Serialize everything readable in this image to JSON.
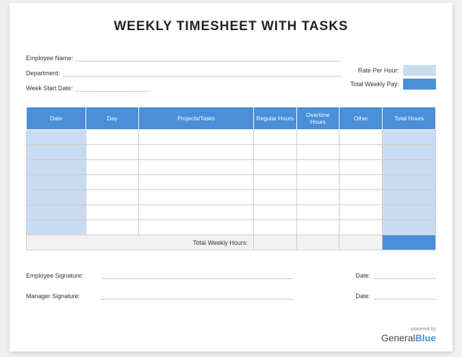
{
  "title": "WEEKLY TIMESHEET WITH TASKS",
  "fields": {
    "employee_name_label": "Employee Name:",
    "department_label": "Department:",
    "week_start_label": "Week Start Date:",
    "rate_label": "Rate Per Hour:",
    "total_pay_label": "Total Weekly Pay:"
  },
  "table": {
    "headers": {
      "date": "Date",
      "day": "Day",
      "projects": "Projects/Tasks",
      "regular": "Regular Hours",
      "overtime": "Overtime Hours",
      "other": "Other",
      "total": "Total Hours"
    },
    "rows": [
      {
        "date": "",
        "day": "",
        "proj": "",
        "reg": "",
        "ot": "",
        "other": "",
        "total": ""
      },
      {
        "date": "",
        "day": "",
        "proj": "",
        "reg": "",
        "ot": "",
        "other": "",
        "total": ""
      },
      {
        "date": "",
        "day": "",
        "proj": "",
        "reg": "",
        "ot": "",
        "other": "",
        "total": ""
      },
      {
        "date": "",
        "day": "",
        "proj": "",
        "reg": "",
        "ot": "",
        "other": "",
        "total": ""
      },
      {
        "date": "",
        "day": "",
        "proj": "",
        "reg": "",
        "ot": "",
        "other": "",
        "total": ""
      },
      {
        "date": "",
        "day": "",
        "proj": "",
        "reg": "",
        "ot": "",
        "other": "",
        "total": ""
      },
      {
        "date": "",
        "day": "",
        "proj": "",
        "reg": "",
        "ot": "",
        "other": "",
        "total": ""
      }
    ],
    "total_row_label": "Total Weekly Hours:"
  },
  "signatures": {
    "employee_label": "Employee Signature:",
    "manager_label": "Manager Signature:",
    "date_label": "Date:"
  },
  "footer": {
    "powered": "powered by",
    "brand1": "General",
    "brand2": "Blue"
  }
}
